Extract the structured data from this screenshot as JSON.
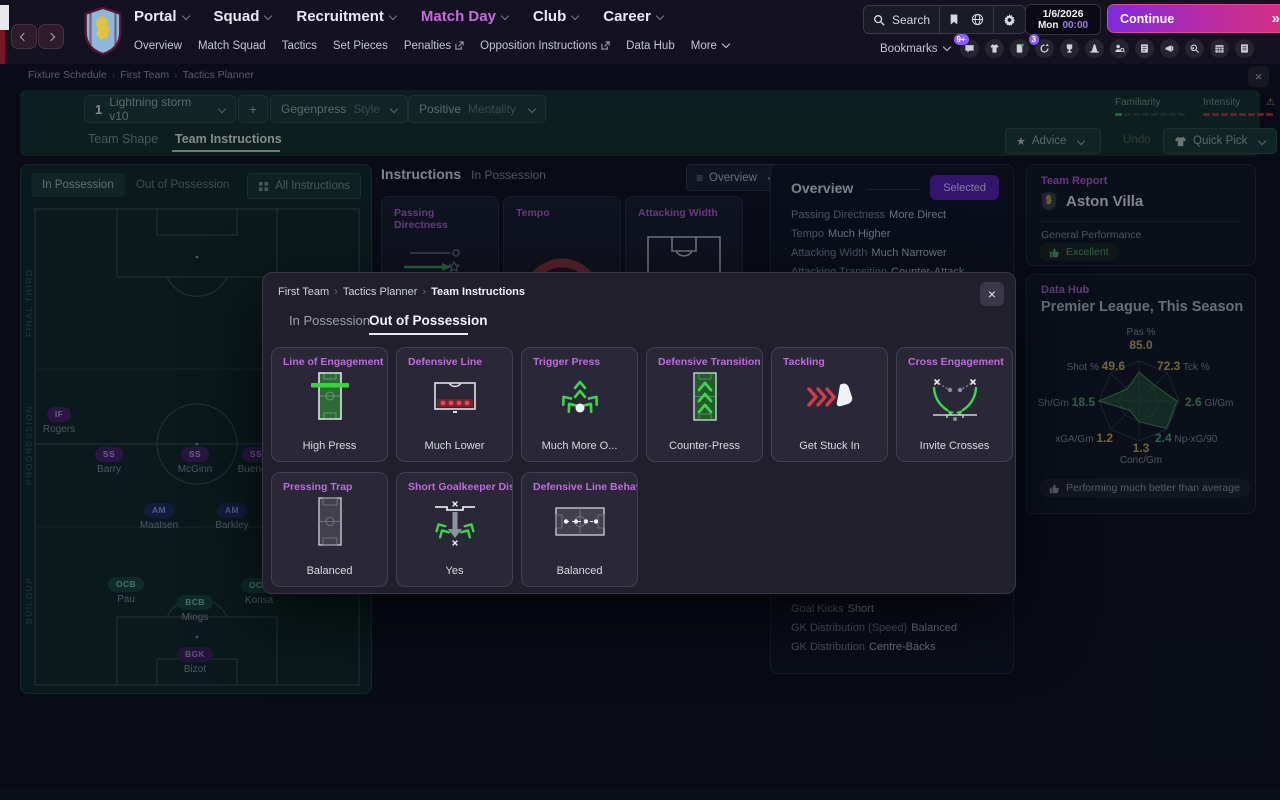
{
  "colors": {
    "accent_magenta": "#c06ae0",
    "selected_purple": "#5a1fb8",
    "continue_gradient_start": "#7e2bdd",
    "continue_gradient_end": "#d6317e",
    "teal_panel": "#133029",
    "familiarity_green": "#3fae5f",
    "intensity_red": "#b5373f",
    "stat_yellow": "#c9b458",
    "stat_green": "#4fae72",
    "badge_purple": "#8b5cf6"
  },
  "topbar": {
    "nav": [
      "Portal",
      "Squad",
      "Recruitment",
      "Match Day",
      "Club",
      "Career"
    ],
    "active_nav": "Match Day",
    "subnav": [
      "Overview",
      "Match Squad",
      "Tactics",
      "Set Pieces",
      "Penalties",
      "Opposition Instructions",
      "Data Hub",
      "More"
    ],
    "search_label": "Search",
    "date": {
      "date": "1/6/2026",
      "day": "Mon",
      "time": "00:00"
    },
    "continue_label": "Continue",
    "bookmarks_label": "Bookmarks",
    "badges": {
      "messages": "9+",
      "news": "3"
    }
  },
  "breadcrumb": {
    "items": [
      "Fixture Schedule",
      "First Team",
      "Tactics Planner"
    ]
  },
  "tactic_bar": {
    "slot": "1",
    "name": "Lightning storm v10",
    "add_label": "+",
    "style_value": "Gegenpress",
    "style_label": "Style",
    "mentality_value": "Positive",
    "mentality_label": "Mentality",
    "familiarity_label": "Familiarity",
    "intensity_label": "Intensity",
    "tabs": [
      "Team Shape",
      "Team Instructions"
    ],
    "active_tab": "Team Instructions",
    "advice_label": "Advice",
    "undo_label": "Undo",
    "quick_pick_label": "Quick Pick"
  },
  "pitch_panel": {
    "tabs": [
      "In Possession",
      "Out of Possession"
    ],
    "active_tab": "In Possession",
    "all_instructions_label": "All Instructions",
    "zones": [
      "FINAL THIRD",
      "PROGRESSION",
      "BUILDUP"
    ],
    "players": [
      {
        "role": "IF",
        "name": "Rogers"
      },
      {
        "role": "SS",
        "name": "Barry"
      },
      {
        "role": "SS",
        "name": "McGinn"
      },
      {
        "role": "SS",
        "name": "Buendia"
      },
      {
        "role": "AM",
        "name": "Maatsen"
      },
      {
        "role": "AM",
        "name": "Barkley"
      },
      {
        "role": "OCB",
        "name": "Pau"
      },
      {
        "role": "OCB",
        "name": "Konsa"
      },
      {
        "role": "BCB",
        "name": "Mings"
      },
      {
        "role": "BGK",
        "name": "Bizot"
      }
    ]
  },
  "instructions_panel": {
    "title": "Instructions",
    "subtitle": "In Possession",
    "view_label": "Overview",
    "cards": [
      {
        "title": "Passing Directness"
      },
      {
        "title": "Tempo"
      },
      {
        "title": "Attacking Width"
      }
    ]
  },
  "overview_panel": {
    "title": "Overview",
    "selected_label": "Selected",
    "items_top": [
      {
        "label": "Passing Directness",
        "value": "More Direct"
      },
      {
        "label": "Tempo",
        "value": "Much Higher"
      },
      {
        "label": "Attacking Width",
        "value": "Much Narrower"
      },
      {
        "label": "Attacking Transition",
        "value": "Counter-Attack"
      }
    ],
    "items_bottom": [
      {
        "label": "Goal Kicks",
        "value": "Short"
      },
      {
        "label": "GK Distribution (Speed)",
        "value": "Balanced"
      },
      {
        "label": "GK Distribution",
        "value": "Centre-Backs"
      }
    ]
  },
  "team_report": {
    "title": "Team Report",
    "team": "Aston Villa",
    "section": "General Performance",
    "rating": "Excellent"
  },
  "data_hub": {
    "title": "Data Hub",
    "subtitle": "Premier League, This Season",
    "note": "Performing much better than average"
  },
  "chart_data": {
    "type": "radar",
    "title": "Premier League, This Season",
    "axes": [
      {
        "label": "Pas %",
        "value": 85.0,
        "display": "85.0",
        "r": 0.72,
        "color": "#c9b458"
      },
      {
        "label": "Tck %",
        "value": 72.3,
        "display": "72.3",
        "r": 0.55,
        "color": "#c9b458"
      },
      {
        "label": "Gl/Gm",
        "value": 2.6,
        "display": "2.6",
        "r": 0.95,
        "color": "#4fae72"
      },
      {
        "label": "Np-xG/90",
        "value": 2.4,
        "display": "2.4",
        "r": 0.97,
        "color": "#4fae72"
      },
      {
        "label": "Conc/Gm",
        "value": 1.3,
        "display": "1.3",
        "r": 0.52,
        "color": "#c9b458"
      },
      {
        "label": "xGA/Gm",
        "value": 1.2,
        "display": "1.2",
        "r": 0.33,
        "color": "#c9b458"
      },
      {
        "label": "Sh/Gm",
        "value": 18.5,
        "display": "18.5",
        "r": 1.0,
        "color": "#4fae72"
      },
      {
        "label": "Shot %",
        "value": 49.6,
        "display": "49.6",
        "r": 0.42,
        "color": "#c9b458"
      }
    ]
  },
  "modal": {
    "breadcrumb": [
      "First Team",
      "Tactics Planner",
      "Team Instructions"
    ],
    "tabs": [
      "In Possession",
      "Out of Possession"
    ],
    "active_tab": "Out of Possession",
    "cards": [
      {
        "title": "Line of Engagement",
        "value": "High Press",
        "icon": "line-of-engagement-icon"
      },
      {
        "title": "Defensive Line",
        "value": "Much Lower",
        "icon": "defensive-line-icon"
      },
      {
        "title": "Trigger Press",
        "value": "Much More O...",
        "icon": "trigger-press-icon"
      },
      {
        "title": "Defensive Transition",
        "value": "Counter-Press",
        "icon": "defensive-transition-icon"
      },
      {
        "title": "Tackling",
        "value": "Get Stuck In",
        "icon": "tackling-icon"
      },
      {
        "title": "Cross Engagement",
        "value": "Invite Crosses",
        "icon": "cross-engagement-icon"
      },
      {
        "title": "Pressing Trap",
        "value": "Balanced",
        "icon": "pressing-trap-icon"
      },
      {
        "title": "Short Goalkeeper Distr",
        "value": "Yes",
        "icon": "short-gk-distribution-icon"
      },
      {
        "title": "Defensive Line Behavio",
        "value": "Balanced",
        "icon": "defensive-line-behaviour-icon"
      }
    ]
  }
}
